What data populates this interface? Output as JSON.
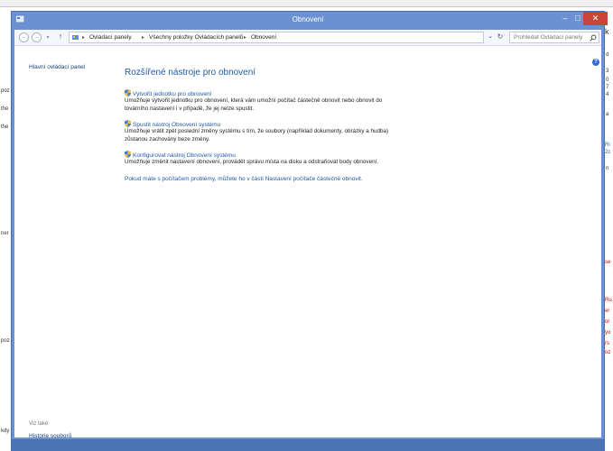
{
  "window": {
    "title": "Obnovení",
    "minimize": "–",
    "maximize": "□",
    "close": "✕"
  },
  "navbar": {
    "back": "←",
    "forward": "→",
    "up": "↑",
    "breadcrumb": [
      "Ovládací panely",
      "Všechny položky Ovládacích panelů",
      "Obnovení"
    ],
    "search_placeholder": "Prohledat Ovládací panely"
  },
  "left_pane": {
    "home_link": "Hlavní ovládací panel",
    "see_also": "Viz také",
    "file_history": "Historie souborů"
  },
  "main": {
    "title": "Rozšířené nástroje pro obnovení",
    "tools": [
      {
        "link": "Vytvořit jednotku pro obnovení",
        "description": "Umožňuje vytvořit jednotku pro obnovení, která vám umožní počítač částečně obnovit nebo obnovit do továrního nastavení i v případě, že jej nelze spustit."
      },
      {
        "link": "Spustit nástroj Obnovení systému",
        "description": "Umožňuje vrátit zpět poslední změny systému s tím, že soubory (například dokumenty, obrázky a hudba) zůstanou zachovány beze změny."
      },
      {
        "link": "Konfigurovat nástroj Obnovení systému",
        "description": "Umožňuje změnit nastavení obnovení, provádět správu místa na disku a odstraňovat body obnovení."
      }
    ],
    "footer_link": "Pokud máte s počítačem problémy, můžete ho v části Nastavení počítače částečně obnovit."
  },
  "background": {
    "left_snippets": [
      "poz",
      "the",
      "the",
      "ner",
      "poz",
      "kdy"
    ],
    "right_snippets": [
      "k",
      "d",
      "3",
      "0",
      "7",
      "4",
      "a",
      "Ri",
      "2c",
      "n",
      "se",
      "Ru",
      "er",
      "ol",
      "yo",
      "rs",
      "oz"
    ]
  },
  "colors": {
    "window_frame": "#6b91d2",
    "close_button": "#c9453a",
    "link": "#1e5aa8",
    "title": "#1e5aa8"
  }
}
